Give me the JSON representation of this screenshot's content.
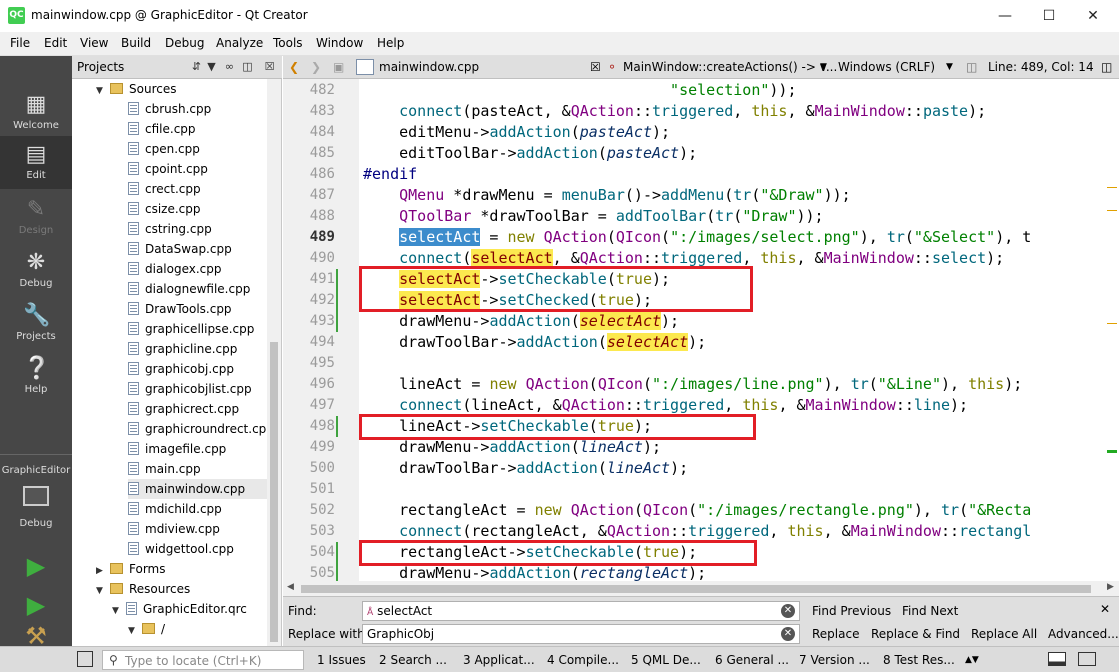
{
  "window": {
    "title": "mainwindow.cpp @ GraphicEditor - Qt Creator",
    "logo": "QC"
  },
  "menu": [
    "File",
    "Edit",
    "View",
    "Build",
    "Debug",
    "Analyze",
    "Tools",
    "Window",
    "Help"
  ],
  "modes": [
    {
      "label": "Welcome",
      "icon": "grid-icon"
    },
    {
      "label": "Edit",
      "icon": "document-icon"
    },
    {
      "label": "Design",
      "icon": "pen-icon"
    },
    {
      "label": "Debug",
      "icon": "bug-icon"
    },
    {
      "label": "Projects",
      "icon": "wrench-icon"
    },
    {
      "label": "Help",
      "icon": "help-icon"
    }
  ],
  "kit": {
    "project": "GraphicEditor",
    "config": "Debug"
  },
  "projects_panel": {
    "title": "Projects",
    "tree": [
      {
        "label": "Sources",
        "type": "folder"
      },
      {
        "label": "cbrush.cpp"
      },
      {
        "label": "cfile.cpp"
      },
      {
        "label": "cpen.cpp"
      },
      {
        "label": "cpoint.cpp"
      },
      {
        "label": "crect.cpp"
      },
      {
        "label": "csize.cpp"
      },
      {
        "label": "cstring.cpp"
      },
      {
        "label": "DataSwap.cpp"
      },
      {
        "label": "dialogex.cpp"
      },
      {
        "label": "dialognewfile.cpp"
      },
      {
        "label": "DrawTools.cpp"
      },
      {
        "label": "graphicellipse.cpp"
      },
      {
        "label": "graphicline.cpp"
      },
      {
        "label": "graphicobj.cpp"
      },
      {
        "label": "graphicobjlist.cpp"
      },
      {
        "label": "graphicrect.cpp"
      },
      {
        "label": "graphicroundrect.cpp"
      },
      {
        "label": "imagefile.cpp"
      },
      {
        "label": "main.cpp"
      },
      {
        "label": "mainwindow.cpp",
        "selected": true
      },
      {
        "label": "mdichild.cpp"
      },
      {
        "label": "mdiview.cpp"
      },
      {
        "label": "widgettool.cpp"
      },
      {
        "label": "Forms",
        "type": "folder"
      },
      {
        "label": "Resources",
        "type": "folder"
      },
      {
        "label": "GraphicEditor.qrc",
        "type": "qrc"
      },
      {
        "label": "/",
        "type": "folder"
      }
    ]
  },
  "editor": {
    "file": "mainwindow.cpp",
    "symbol": "MainWindow::createActions() -> v...",
    "encoding": "Windows (CRLF)",
    "position": "Line: 489, Col: 14",
    "line_numbers": [
      "482",
      "483",
      "484",
      "485",
      "486",
      "487",
      "488",
      "489",
      "490",
      "491",
      "492",
      "493",
      "494",
      "495",
      "496",
      "497",
      "498",
      "499",
      "500",
      "501",
      "502",
      "503",
      "504",
      "505"
    ],
    "current_line": "489"
  },
  "find": {
    "find_label": "Find:",
    "find_value": "selectAct",
    "replace_label": "Replace with:",
    "replace_value": "GraphicObj",
    "find_previous": "Find Previous",
    "find_next": "Find Next",
    "replace": "Replace",
    "replace_find": "Replace & Find",
    "replace_all": "Replace All",
    "advanced": "Advanced..."
  },
  "status": {
    "locate_placeholder": "Type to locate (Ctrl+K)",
    "tabs": [
      "1 Issues",
      "2 Search ...",
      "3 Applicat...",
      "4 Compile...",
      "5 QML De...",
      "6 General ...",
      "7 Version ...",
      "8 Test Res..."
    ]
  }
}
